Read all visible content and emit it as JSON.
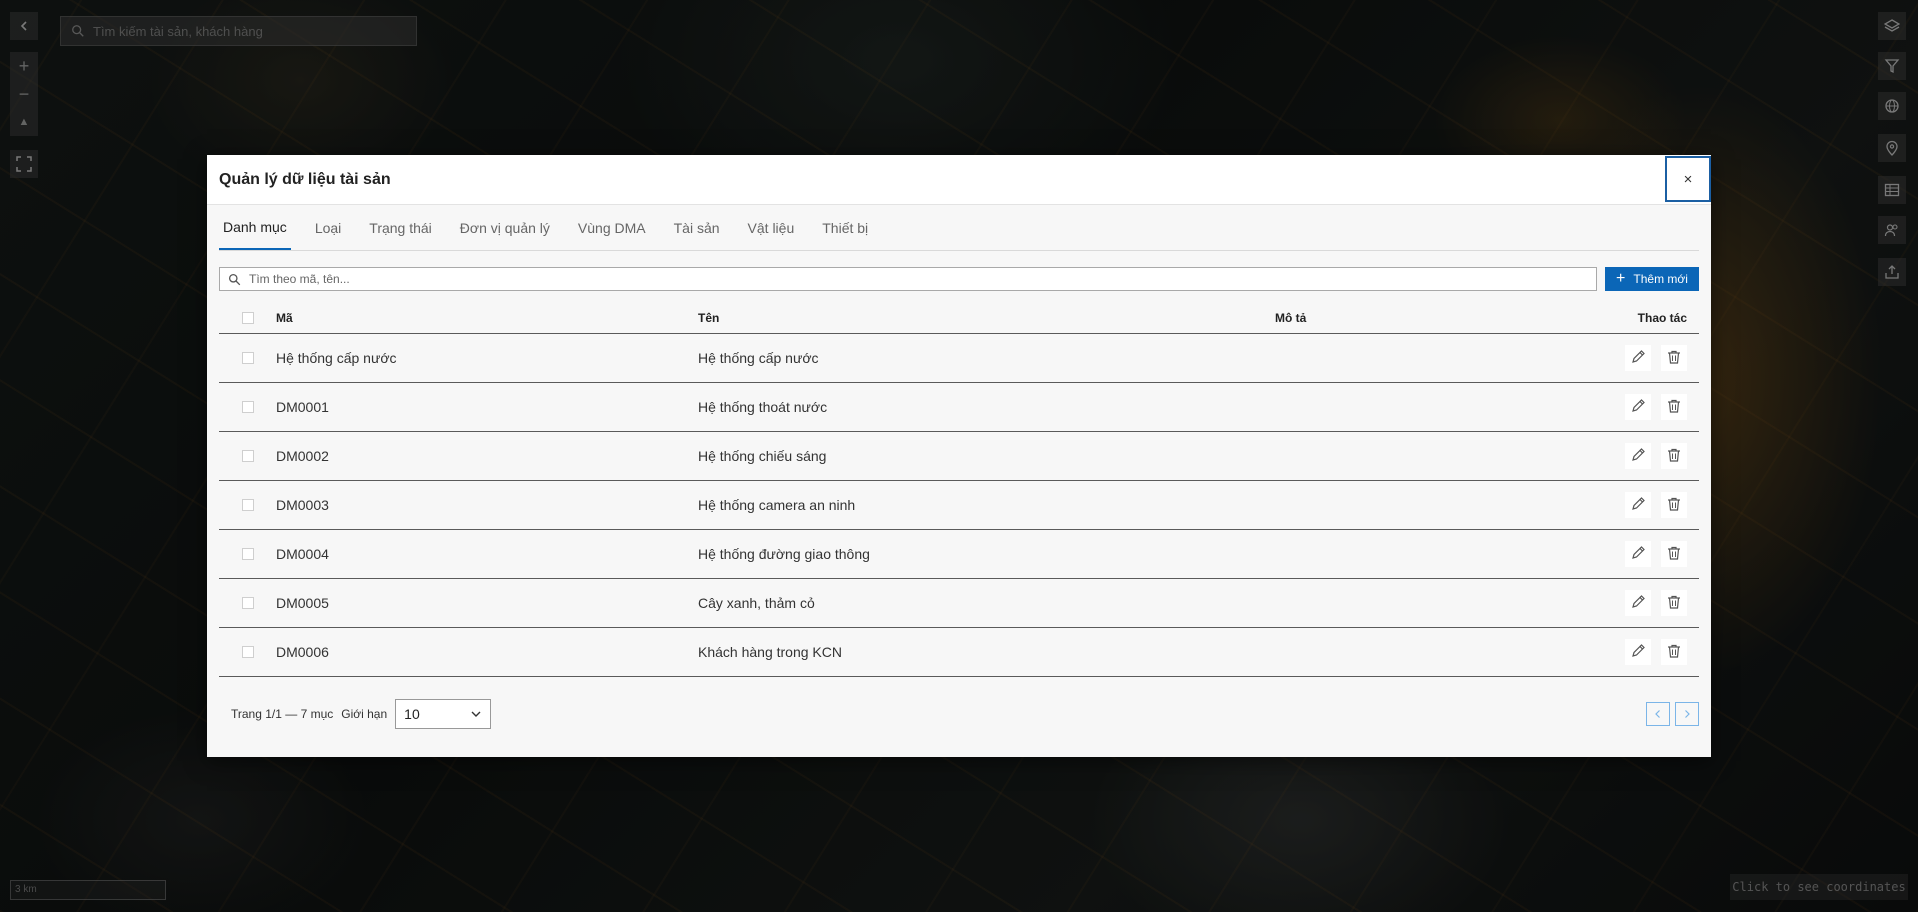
{
  "map": {
    "search_placeholder": "Tìm kiếm tài sản, khách hàng",
    "scale_label": "3 km",
    "coords_label": "Click to see coordinates",
    "left_controls": [
      "back-icon",
      "zoom-in-icon",
      "zoom-out-icon",
      "compass-icon",
      "fullscreen-icon"
    ],
    "right_controls": [
      "layers-icon",
      "filter-icon",
      "globe-icon",
      "location-pin-icon",
      "table-icon",
      "users-icon",
      "export-icon"
    ]
  },
  "modal": {
    "title": "Quản lý dữ liệu tài sản",
    "close_label": "×",
    "tabs": [
      "Danh mục",
      "Loại",
      "Trạng thái",
      "Đơn vị quản lý",
      "Vùng DMA",
      "Tài sản",
      "Vật liệu",
      "Thiết bị"
    ],
    "active_tab": "Danh mục",
    "search_placeholder": "Tìm theo mã, tên...",
    "add_button": "Thêm mới",
    "columns": {
      "code": "Mã",
      "name": "Tên",
      "description": "Mô tả",
      "actions": "Thao tác"
    },
    "rows": [
      {
        "code": "Hệ thống cấp nước",
        "name": "Hệ thống cấp nước",
        "description": ""
      },
      {
        "code": "DM0001",
        "name": "Hệ thống thoát nước",
        "description": ""
      },
      {
        "code": "DM0002",
        "name": "Hệ thống chiếu sáng",
        "description": ""
      },
      {
        "code": "DM0003",
        "name": "Hệ thống camera an ninh",
        "description": ""
      },
      {
        "code": "DM0004",
        "name": "Hệ thống đường giao thông",
        "description": ""
      },
      {
        "code": "DM0005",
        "name": "Cây xanh, thảm cỏ",
        "description": ""
      },
      {
        "code": "DM0006",
        "name": "Khách hàng trong KCN",
        "description": ""
      }
    ],
    "pagination": {
      "info": "Trang 1/1 — 7 mục",
      "limit_label": "Giới hạn",
      "limit_value": "10"
    }
  },
  "colors": {
    "accent": "#0b66b7",
    "close_border": "#1b5fa3",
    "pager_border": "#7bb5e8"
  }
}
